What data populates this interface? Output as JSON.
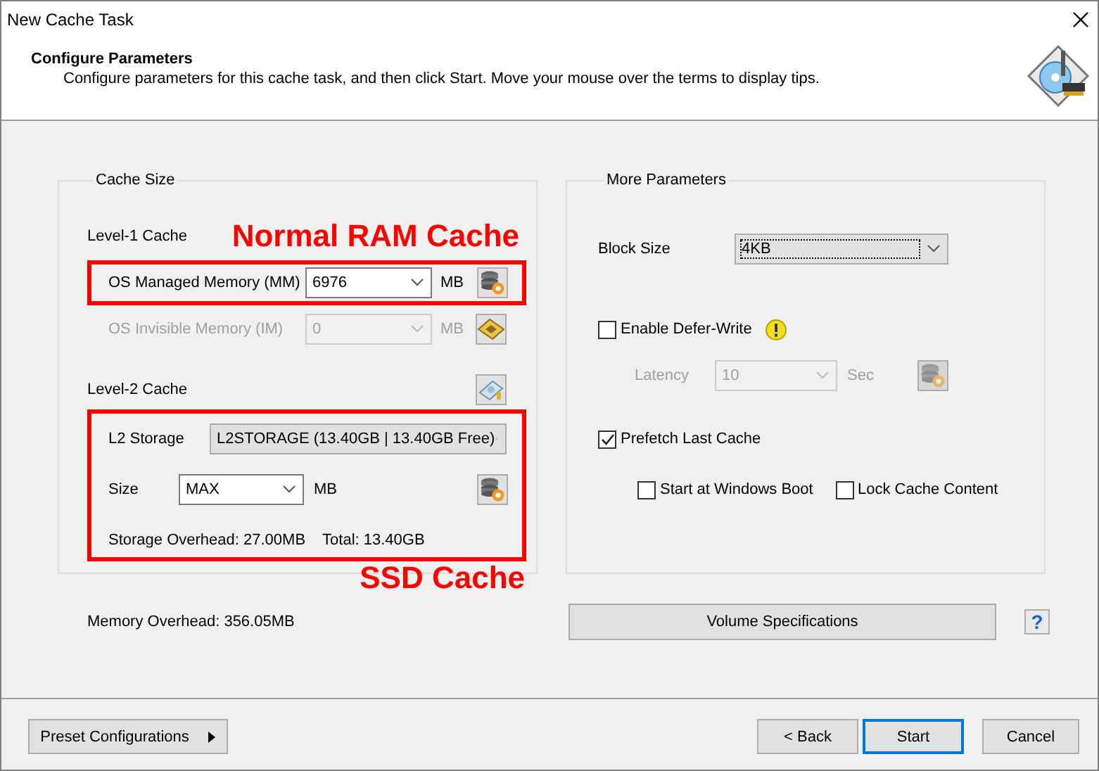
{
  "window": {
    "title": "New Cache Task"
  },
  "header": {
    "title": "Configure Parameters",
    "subtitle": "Configure parameters for this cache task, and then click Start. Move your mouse over the terms to display tips."
  },
  "cache_size": {
    "title": "Cache Size",
    "level1": {
      "label": "Level-1 Cache",
      "fields": [
        {
          "label": "OS Managed Memory (MM)",
          "value": "6976",
          "unit": "MB",
          "disabled": false
        },
        {
          "label": "OS Invisible Memory (IM)",
          "value": "0",
          "unit": "MB",
          "disabled": true
        }
      ]
    },
    "level2": {
      "label": "Level-2 Cache",
      "storage": {
        "label": "L2 Storage",
        "value": "L2STORAGE (13.40GB | 13.40GB Free)"
      },
      "size": {
        "label": "Size",
        "value": "MAX",
        "unit": "MB"
      },
      "storage_overhead": "Storage Overhead: 27.00MB",
      "total": "Total: 13.40GB"
    }
  },
  "more_parameters": {
    "title": "More Parameters",
    "block_size": {
      "label": "Block Size",
      "value": "4KB"
    },
    "defer_write": {
      "label": "Enable Defer-Write",
      "checked": false
    },
    "latency": {
      "label": "Latency",
      "value": "10",
      "unit": "Sec",
      "disabled": true
    },
    "prefetch": {
      "label": "Prefetch Last Cache",
      "checked": true
    },
    "options": [
      {
        "label": "Start at Windows Boot",
        "checked": false
      },
      {
        "label": "Lock Cache Content",
        "checked": false
      }
    ]
  },
  "memory_overhead": "Memory Overhead: 356.05MB",
  "volume_button": "Volume Specifications",
  "help_button": "?",
  "annotations": [
    {
      "text": "Normal RAM Cache"
    },
    {
      "text": "SSD Cache"
    }
  ],
  "footer": {
    "preset": "Preset Configurations",
    "buttons": [
      {
        "label": "< Back",
        "default": false
      },
      {
        "label": "Start",
        "default": true
      },
      {
        "label": "Cancel",
        "default": false
      }
    ]
  }
}
